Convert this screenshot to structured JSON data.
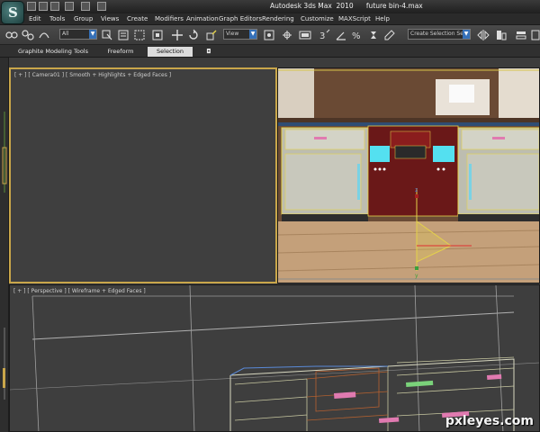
{
  "window": {
    "app_name": "Autodesk 3ds Max  2010",
    "file_name": "future bin-4.max",
    "logo_letter": "S"
  },
  "menu": [
    "Edit",
    "Tools",
    "Group",
    "Views",
    "Create",
    "Modifiers",
    "Animation",
    "Graph Editors",
    "Rendering",
    "Customize",
    "MAXScript",
    "Help"
  ],
  "toolbar": {
    "selection_filter": "All",
    "ref_coord": "View",
    "selection_set_placeholder": "Create Selection Se"
  },
  "ribbon": {
    "tabs": [
      "Graphite Modeling Tools",
      "Freeform",
      "Selection"
    ],
    "active_tab": "Selection"
  },
  "viewports": {
    "camera_label": "[ + ] [ Camera01 ] [ Smooth + Highlights + Edged Faces ]",
    "perspective_label": "[ + ] [ Perspective ] [ Wireframe + Edged Faces ]"
  },
  "gizmo_axes": {
    "z": "z",
    "y": "y"
  },
  "watermark": "pxleyes.com",
  "colors": {
    "selection_yellow": "#e5d24a",
    "accent_teal": "#3a6c6a",
    "active_tab": "#dcdcdc"
  }
}
